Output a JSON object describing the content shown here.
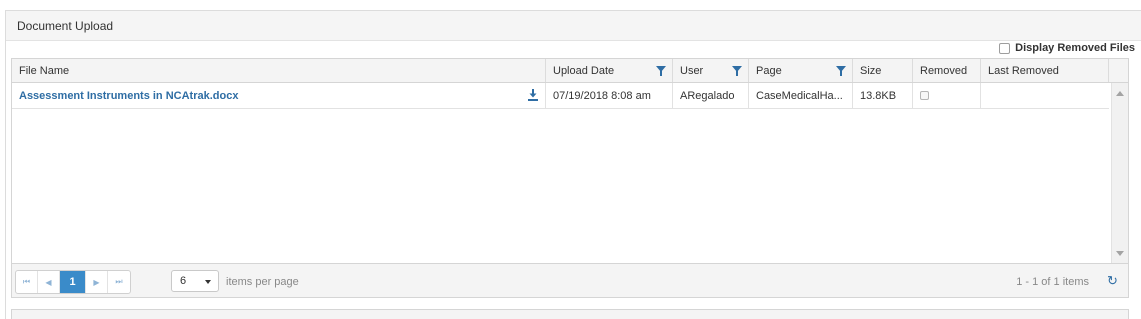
{
  "panel": {
    "title": "Document Upload"
  },
  "options": {
    "display_removed_label": "Display Removed Files"
  },
  "grid": {
    "columns": [
      {
        "key": "file_name",
        "label": "File Name",
        "filter": false
      },
      {
        "key": "upload_date",
        "label": "Upload Date",
        "filter": true
      },
      {
        "key": "user",
        "label": "User",
        "filter": true
      },
      {
        "key": "page",
        "label": "Page",
        "filter": true
      },
      {
        "key": "size",
        "label": "Size",
        "filter": false
      },
      {
        "key": "removed",
        "label": "Removed",
        "filter": false
      },
      {
        "key": "last_removed",
        "label": "Last Removed",
        "filter": false
      }
    ],
    "rows": [
      {
        "file_name": "Assessment Instruments in NCAtrak.docx",
        "upload_date": "07/19/2018 8:08 am",
        "user": "ARegalado",
        "page": "CaseMedicalHa...",
        "size": "13.8KB",
        "removed": false,
        "last_removed": ""
      }
    ]
  },
  "pager": {
    "current_page": "1",
    "page_size": "6",
    "items_per_page_label": "items per page",
    "info": "1 - 1 of 1 items"
  },
  "colors": {
    "link": "#2e6da4",
    "active_page": "#3a8bc9"
  }
}
